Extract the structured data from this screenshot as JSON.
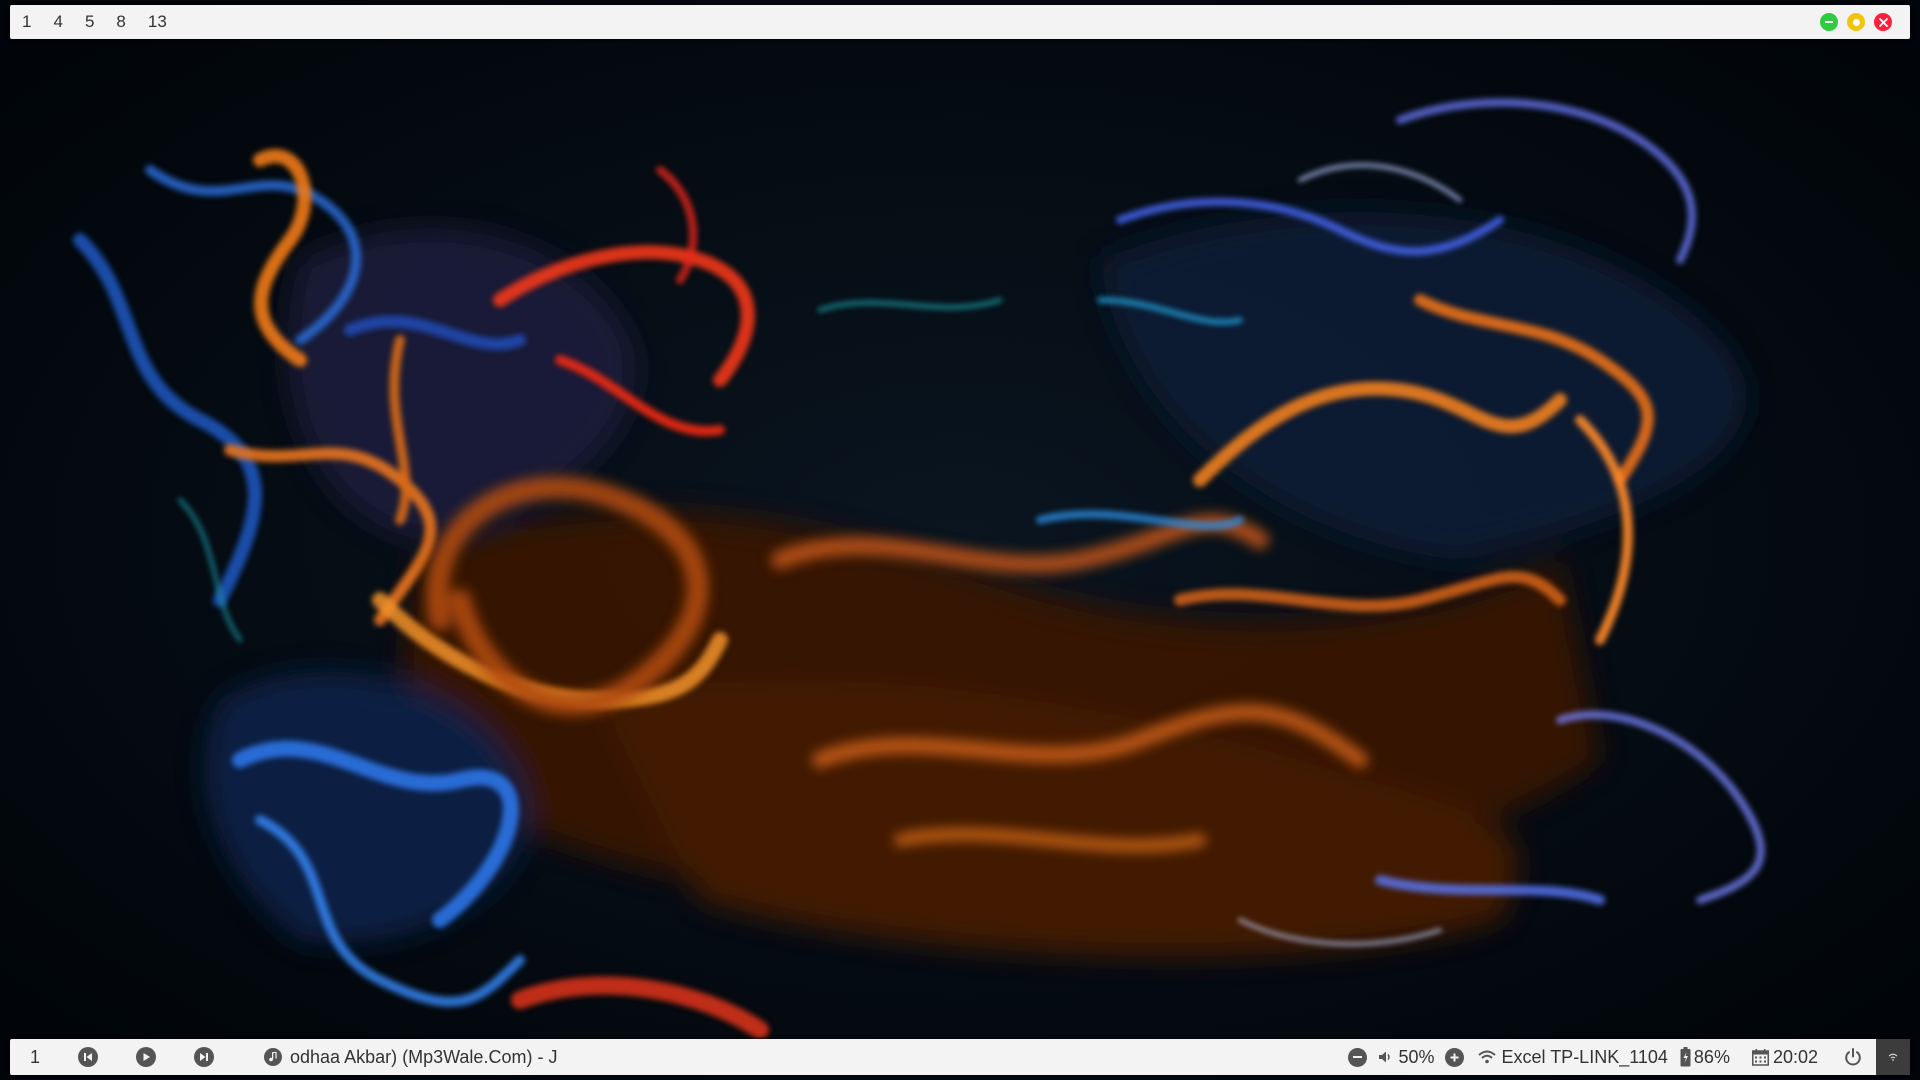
{
  "topbar": {
    "workspaces": [
      "1",
      "4",
      "5",
      "8",
      "13"
    ],
    "controls": {
      "minimize_color": "#2ecc40",
      "maximize_color": "#f1c40f",
      "close_color": "#ff1f3d"
    }
  },
  "bottombar": {
    "workspace": "1",
    "now_playing": "odhaa Akbar) (Mp3Wale.Com) - J",
    "volume": "50%",
    "network": "Excel TP-LINK_1104",
    "battery": "86%",
    "clock": "20:02"
  },
  "colors": {
    "bar_background": "#f3f3f3",
    "text": "#333333",
    "icon": "#555555",
    "wallpaper_base": "#02070c"
  }
}
